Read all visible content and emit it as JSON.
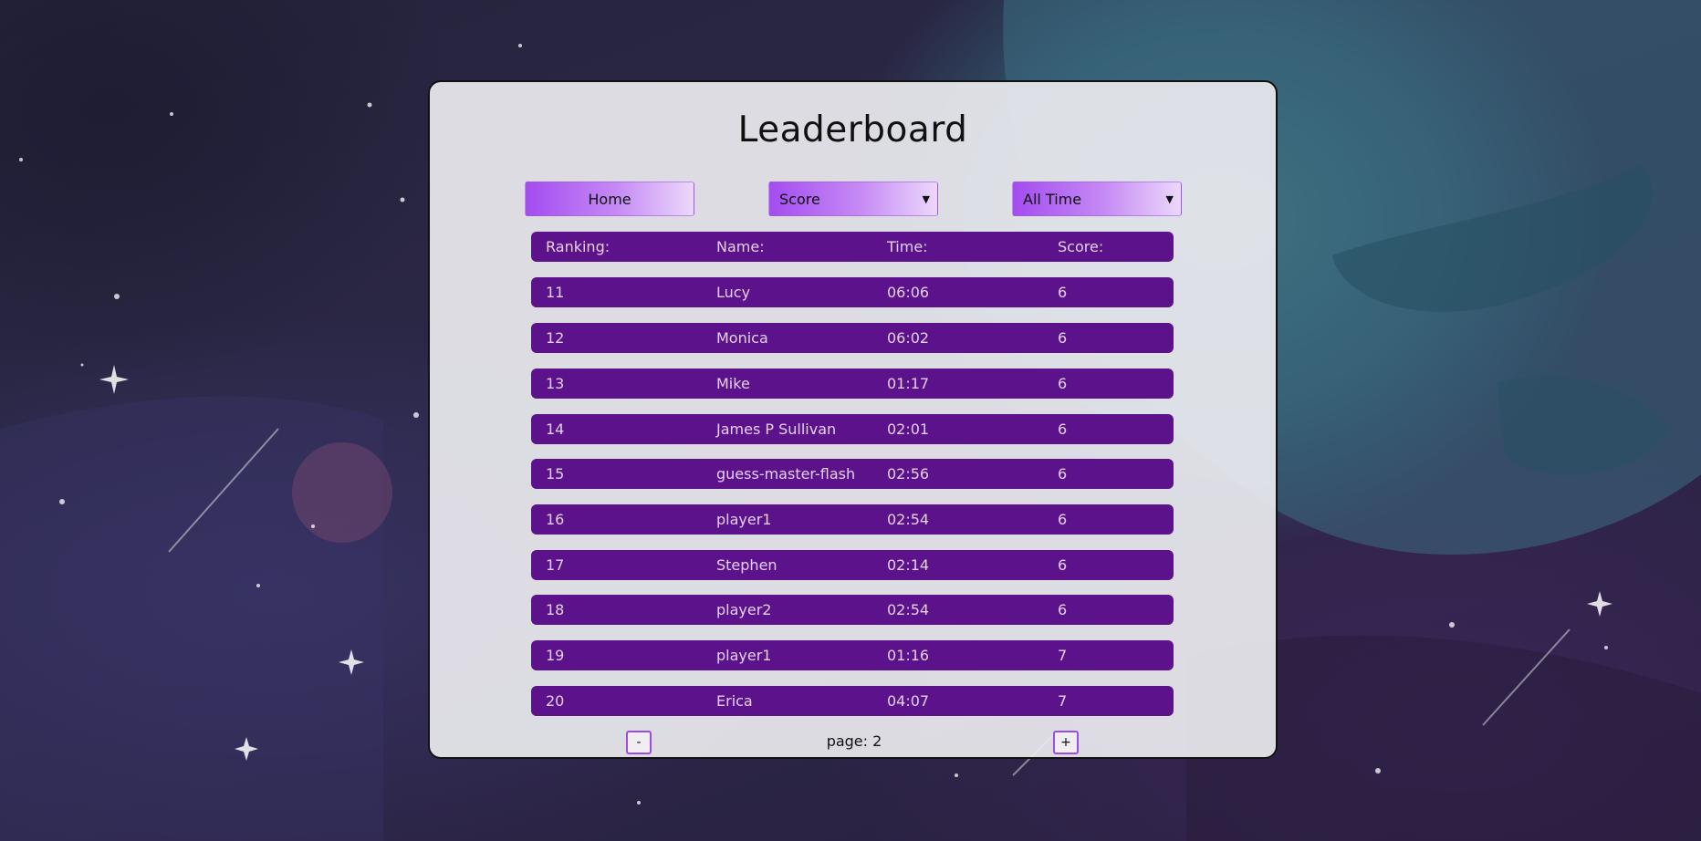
{
  "title": "Leaderboard",
  "controls": {
    "home_label": "Home",
    "sort_by": "Score",
    "time_range": "All Time"
  },
  "table": {
    "headers": [
      "Ranking:",
      "Name:",
      "Time:",
      "Score:"
    ],
    "rows": [
      [
        "11",
        "Lucy",
        "06:06",
        "6"
      ],
      [
        "12",
        "Monica",
        "06:02",
        "6"
      ],
      [
        "13",
        "Mike",
        "01:17",
        "6"
      ],
      [
        "14",
        "James P Sullivan",
        "02:01",
        "6"
      ],
      [
        "15",
        "guess-master-flash",
        "02:56",
        "6"
      ],
      [
        "16",
        "player1",
        "02:54",
        "6"
      ],
      [
        "17",
        "Stephen",
        "02:14",
        "6"
      ],
      [
        "18",
        "player2",
        "02:54",
        "6"
      ],
      [
        "19",
        "player1",
        "01:16",
        "7"
      ],
      [
        "20",
        "Erica",
        "04:07",
        "7"
      ]
    ]
  },
  "pagination": {
    "prev_label": "-",
    "next_label": "+",
    "page_label": "page: 2"
  },
  "colors": {
    "row_bg": "#5c128a",
    "row_text": "#e3d2ef",
    "button_gradient_start": "#a44cf0",
    "button_gradient_end": "#ecd8fb"
  }
}
